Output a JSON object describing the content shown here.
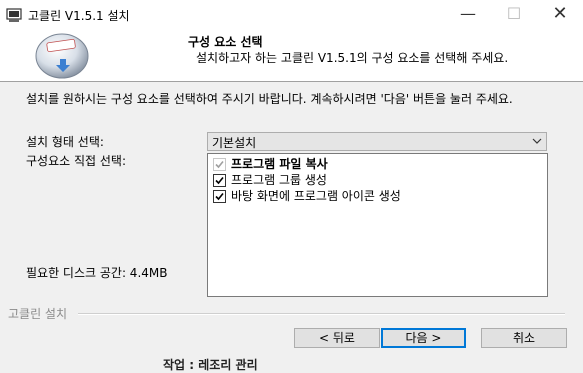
{
  "window": {
    "title": "고클린 V1.5.1 설치",
    "minimize_glyph": "—",
    "maximize_glyph": "☐",
    "close_glyph": "✕"
  },
  "header": {
    "title": "구성 요소 선택",
    "subtitle": "설치하고자 하는 고클린 V1.5.1의 구성 요소를 선택해 주세요."
  },
  "intro_text": "설치를 원하시는 구성 요소를 선택하여 주시기 바랍니다. 계속하시려면 '다음' 버튼을 눌러 주세요.",
  "install_type": {
    "label": "설치 형태 선택:",
    "selected": "기본설치"
  },
  "components": {
    "label": "구성요소 직접 선택:",
    "items": [
      {
        "label": "프로그램 파일 복사",
        "checked": true,
        "disabled": true
      },
      {
        "label": "프로그램 그룹 생성",
        "checked": true,
        "disabled": false
      },
      {
        "label": "바탕 화면에 프로그램 아이콘 생성",
        "checked": true,
        "disabled": false
      }
    ]
  },
  "disk_space": {
    "label": "필요한 디스크 공간: 4.4MB"
  },
  "branding": "고클린 설치",
  "buttons": {
    "back": "< 뒤로",
    "next": "다음 >",
    "cancel": "취소"
  },
  "background_text": "작업 : 레조리 관리",
  "colors": {
    "accent": "#0078d7",
    "check": "#000000",
    "check_disabled": "#a0a0a0"
  }
}
